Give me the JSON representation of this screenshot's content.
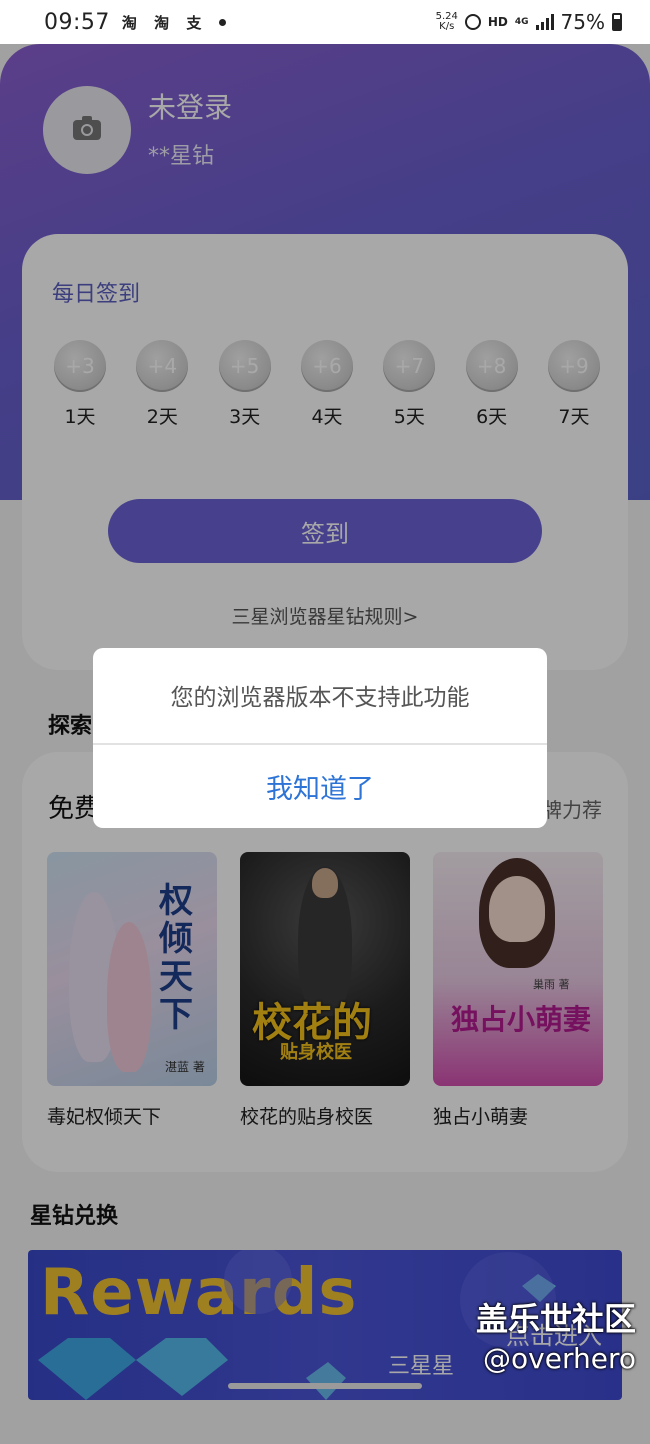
{
  "status_bar": {
    "time": "09:57",
    "notifications": "淘 淘 支",
    "net_speed_value": "5.24",
    "net_speed_unit": "K/s",
    "hd": "HD",
    "network": "4G",
    "battery": "75%"
  },
  "user": {
    "name": "未登录",
    "diamonds": "**星钻"
  },
  "signin": {
    "title": "每日签到",
    "days": [
      {
        "reward": "+3",
        "label": "1天"
      },
      {
        "reward": "+4",
        "label": "2天"
      },
      {
        "reward": "+5",
        "label": "3天"
      },
      {
        "reward": "+6",
        "label": "4天"
      },
      {
        "reward": "+7",
        "label": "5天"
      },
      {
        "reward": "+8",
        "label": "6天"
      },
      {
        "reward": "+9",
        "label": "7天"
      }
    ],
    "button": "签到",
    "rules_link": "三星浏览器星钻规则>"
  },
  "explore": {
    "title": "探索",
    "free_title": "免费",
    "free_right": "牌力荐",
    "books": [
      {
        "title": "毒妃权倾天下",
        "cover_text": "权倾天下",
        "cover_author": "湛蓝 著"
      },
      {
        "title": "校花的贴身校医",
        "cover_text": "校花的",
        "cover_sub": "贴身校医"
      },
      {
        "title": "独占小萌妻",
        "cover_text": "独占小萌妻",
        "cover_author": "巢雨 著"
      }
    ]
  },
  "exchange": {
    "title": "星钻兑换",
    "banner_title": "Rewards",
    "banner_enter": "点击进入",
    "banner_brand": "三星星"
  },
  "dialog": {
    "message": "您的浏览器版本不支持此功能",
    "confirm": "我知道了"
  },
  "watermark": {
    "line1": "盖乐世社区",
    "line2": "@overhero"
  },
  "colors": {
    "accent": "#6d63d6",
    "hero_gradient_start": "#8b5fd0",
    "hero_gradient_end": "#5a62c9",
    "dialog_button": "#2e74d6",
    "rewards_gold": "#f2c233"
  }
}
